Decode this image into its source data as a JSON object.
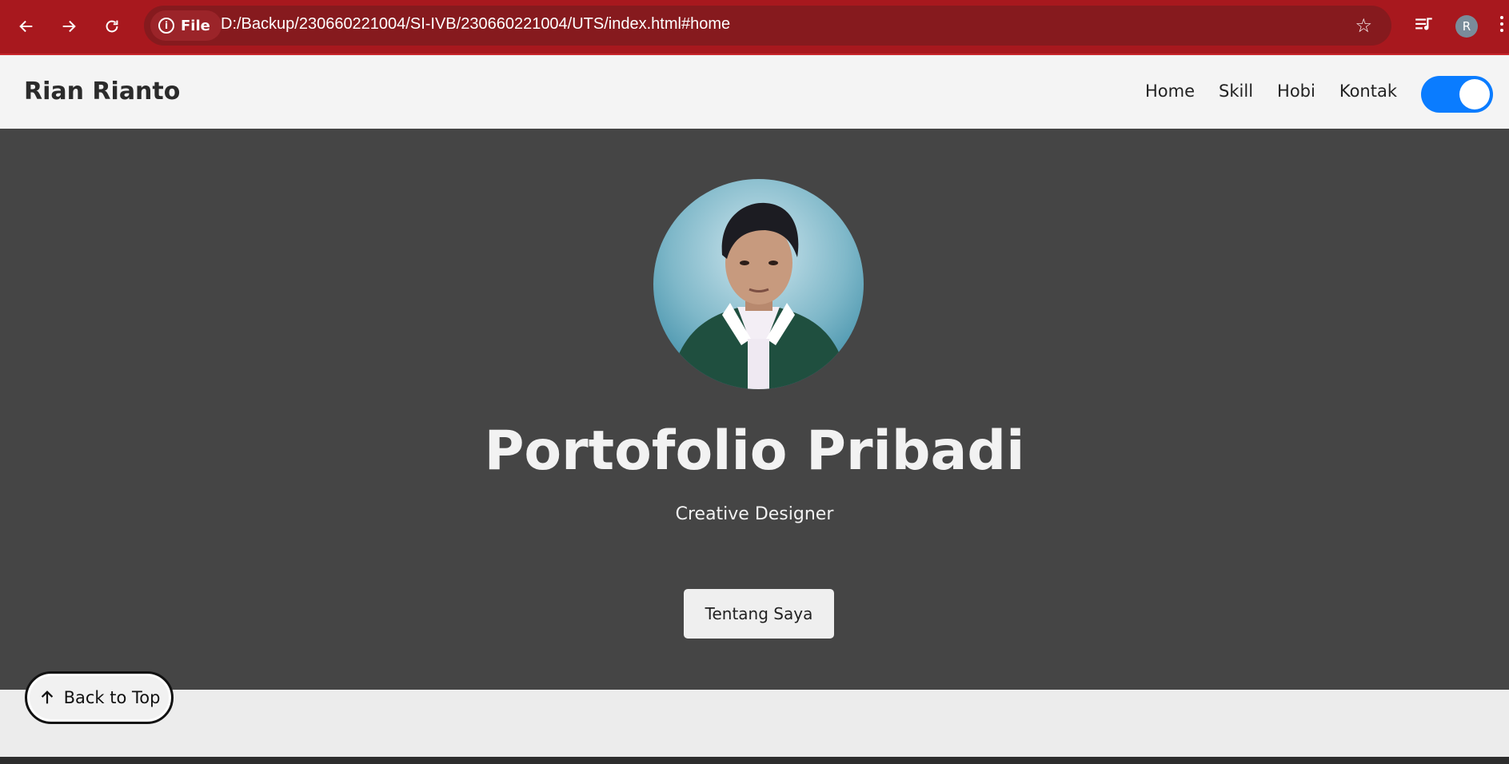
{
  "browser": {
    "site_chip": "File",
    "url": "D:/Backup/230660221004/SI-IVB/230660221004/UTS/index.html#home",
    "profile_initial": "R",
    "icons": [
      "back-icon",
      "forward-icon",
      "reload-icon",
      "info-icon",
      "star-icon",
      "media-controls-icon",
      "kebab-menu-icon"
    ]
  },
  "site": {
    "brand": "Rian Rianto",
    "nav": [
      "Home",
      "Skill",
      "Hobi",
      "Kontak"
    ],
    "theme_toggle_on": true
  },
  "hero": {
    "title": "Portofolio Pribadi",
    "subtitle": "Creative Designer",
    "cta_label": "Tentang Saya"
  },
  "back_to_top": {
    "label": "Back to Top"
  },
  "colors": {
    "chrome": "#a8181e",
    "omnibox": "#861a1e",
    "navbar": "#f4f4f4",
    "hero": "#454545",
    "toggle": "#0a7cff"
  }
}
